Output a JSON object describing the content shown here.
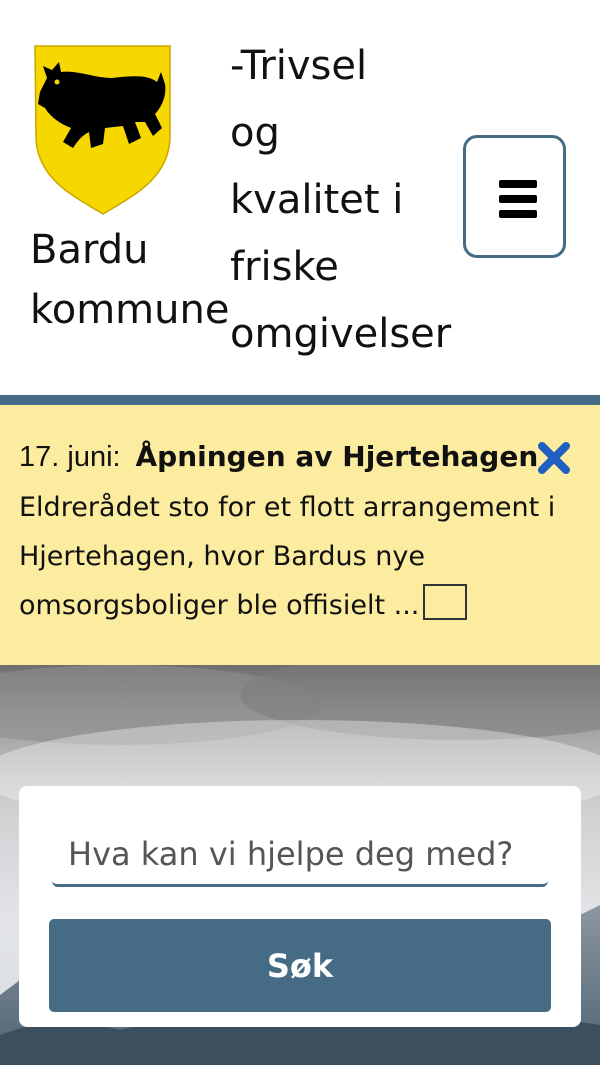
{
  "header": {
    "municipality_name": "Bardu\nkommune",
    "slogan": "-Trivsel\nog\nkvalitet i\nfriske\nomgivelser",
    "menu_icon": "hamburger-icon",
    "logo_icon": "bear-coat-of-arms"
  },
  "news": {
    "date": "17. juni:",
    "title": "Åpningen av Hjertehagen",
    "body": "Eldrerådet sto for et flott arrangement i Hjertehagen, hvor Bardus nye omsorgsboliger ble offisielt ...",
    "close_icon": "close-icon"
  },
  "search": {
    "placeholder": "Hva kan vi hjelpe deg med?",
    "button_label": "Søk"
  },
  "colors": {
    "accent": "#456b85",
    "banner_background": "#fcec9f",
    "coat_of_arms_yellow": "#f7d700",
    "close_icon": "#1f5fbf"
  }
}
